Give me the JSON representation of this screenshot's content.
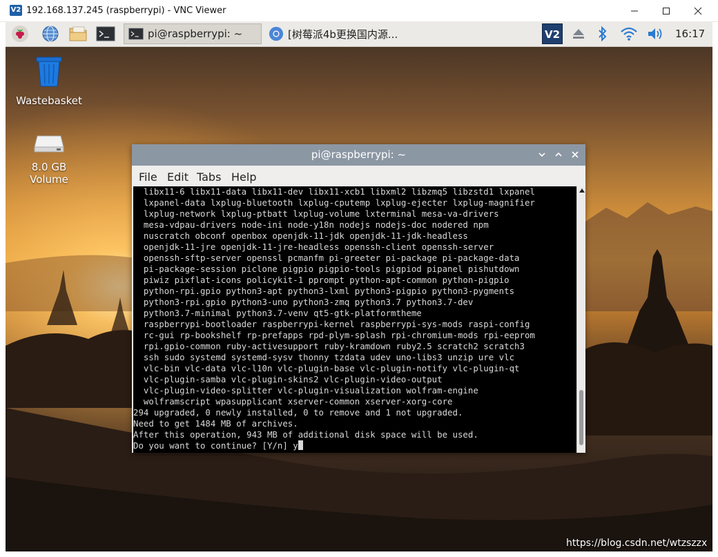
{
  "vnc": {
    "logo_text": "V2",
    "title": "192.168.137.245 (raspberrypi) - VNC Viewer"
  },
  "panel": {
    "tasks": [
      {
        "label": "pi@raspberrypi: ~"
      },
      {
        "label": "[树莓派4b更换国内源..."
      }
    ],
    "clock": "16:17"
  },
  "desktop": {
    "icons": [
      {
        "label": "Wastebasket"
      },
      {
        "label": "8.0 GB Volume"
      }
    ]
  },
  "terminal": {
    "title": "pi@raspberrypi: ~",
    "menu": [
      "File",
      "Edit",
      "Tabs",
      "Help"
    ],
    "lines": [
      "  libx11-6 libx11-data libx11-dev libx11-xcb1 libxml2 libzmq5 libzstd1 lxpanel",
      "  lxpanel-data lxplug-bluetooth lxplug-cputemp lxplug-ejecter lxplug-magnifier",
      "  lxplug-network lxplug-ptbatt lxplug-volume lxterminal mesa-va-drivers",
      "  mesa-vdpau-drivers node-ini node-y18n nodejs nodejs-doc nodered npm",
      "  nuscratch obconf openbox openjdk-11-jdk openjdk-11-jdk-headless",
      "  openjdk-11-jre openjdk-11-jre-headless openssh-client openssh-server",
      "  openssh-sftp-server openssl pcmanfm pi-greeter pi-package pi-package-data",
      "  pi-package-session piclone pigpio pigpio-tools pigpiod pipanel pishutdown",
      "  piwiz pixflat-icons policykit-1 pprompt python-apt-common python-pigpio",
      "  python-rpi.gpio python3-apt python3-lxml python3-pigpio python3-pygments",
      "  python3-rpi.gpio python3-uno python3-zmq python3.7 python3.7-dev",
      "  python3.7-minimal python3.7-venv qt5-gtk-platformtheme",
      "  raspberrypi-bootloader raspberrypi-kernel raspberrypi-sys-mods raspi-config",
      "  rc-gui rp-bookshelf rp-prefapps rpd-plym-splash rpi-chromium-mods rpi-eeprom",
      "  rpi.gpio-common ruby-activesupport ruby-kramdown ruby2.5 scratch2 scratch3",
      "  ssh sudo systemd systemd-sysv thonny tzdata udev uno-libs3 unzip ure vlc",
      "  vlc-bin vlc-data vlc-l10n vlc-plugin-base vlc-plugin-notify vlc-plugin-qt",
      "  vlc-plugin-samba vlc-plugin-skins2 vlc-plugin-video-output",
      "  vlc-plugin-video-splitter vlc-plugin-visualization wolfram-engine",
      "  wolframscript wpasupplicant xserver-common xserver-xorg-core",
      "294 upgraded, 0 newly installed, 0 to remove and 1 not upgraded.",
      "Need to get 1484 MB of archives.",
      "After this operation, 943 MB of additional disk space will be used.",
      "Do you want to continue? [Y/n] y"
    ]
  },
  "watermark": "https://blog.csdn.net/wtzszzx",
  "colors": {
    "terminal_bg": "#000000",
    "terminal_fg": "#d7d7d7",
    "term_titlebar": "#8c97a4",
    "panel_bg": "#eceae6",
    "vnc_blue": "#1f5fa8"
  }
}
